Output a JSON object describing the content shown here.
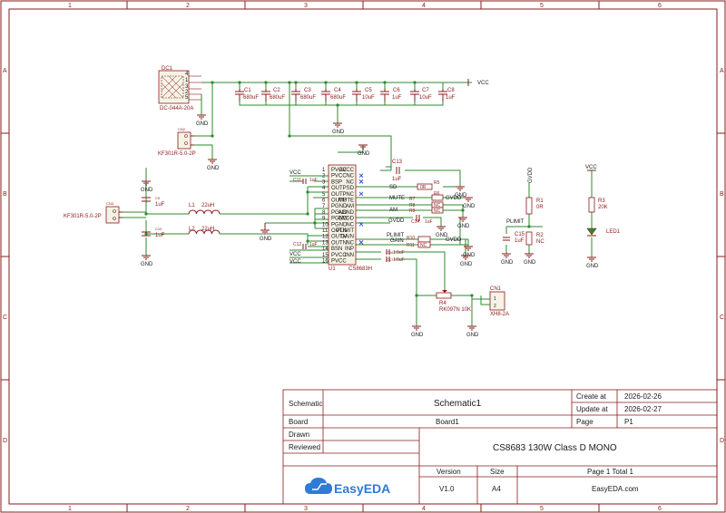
{
  "frame": {
    "columns": [
      "1",
      "2",
      "3",
      "4",
      "5",
      "6"
    ],
    "rows": [
      "A",
      "B",
      "C",
      "D"
    ]
  },
  "title_block": {
    "schematic_label": "Schematic",
    "schematic_name": "Schematic1",
    "board_label": "Board",
    "board_name": "Board1",
    "drawn_label": "Drawn",
    "reviewed_label": "Reviewed",
    "create_label": "Create at",
    "create_date": "2026-02-26",
    "update_label": "Update at",
    "update_date": "2026-02-27",
    "page_label": "Page",
    "page_value": "P1",
    "project_title": "CS8683 130W Class D MONO",
    "version_label": "Version",
    "version_value": "V1.0",
    "size_label": "Size",
    "size_value": "A4",
    "page_count": "Page  1  Total  1",
    "site": "EasyEDA.com",
    "logo_text": "EasyEDA"
  },
  "components": {
    "dc1": {
      "ref": "DC1",
      "value": "DC-044A-20A",
      "pins": [
        "4",
        "1",
        "3",
        "2",
        "5"
      ]
    },
    "c1": {
      "ref": "C1",
      "value": "680uF"
    },
    "c2": {
      "ref": "C2",
      "value": "680uF"
    },
    "c3": {
      "ref": "C3",
      "value": "680uF"
    },
    "c4": {
      "ref": "C4",
      "value": "680uF"
    },
    "c5": {
      "ref": "C5",
      "value": "10uF"
    },
    "c6": {
      "ref": "C6",
      "value": "1uF"
    },
    "c7": {
      "ref": "C7",
      "value": "10uF"
    },
    "c8": {
      "ref": "C8",
      "value": "1uF"
    },
    "cn2": {
      "ref": "CN2",
      "value": "KF301R-5.0-2P"
    },
    "cn3": {
      "ref": "CN3",
      "value": "KF301R-5.0-2P"
    },
    "c9": {
      "ref": "C9",
      "value": "1uF"
    },
    "c10": {
      "ref": "C10",
      "value": "1uF"
    },
    "l1": {
      "ref": "L1",
      "value": "22uH"
    },
    "l2": {
      "ref": "L2",
      "value": "22uH"
    },
    "c11": {
      "ref": "C11",
      "value": "1uF"
    },
    "c12": {
      "ref": "C12",
      "value": "1uF"
    },
    "c13": {
      "ref": "C13",
      "value": "1uF"
    },
    "c14": {
      "ref": "C14",
      "value": "1uF"
    },
    "c16": {
      "ref": "C16",
      "value": "1.5uF"
    },
    "c17": {
      "ref": "C17",
      "value": "1.5uF"
    },
    "u1": {
      "ref": "U1",
      "value": "CS8683H",
      "left_pins": [
        "PVCC",
        "PVCC",
        "BSP",
        "OUTP",
        "OUTP",
        "OUTP",
        "PGND",
        "PGND",
        "PGND",
        "PGND",
        "OUTN",
        "OUTN",
        "OUTN",
        "BSN",
        "PVCC",
        "PVCC"
      ],
      "right_pins": [
        "AVCC",
        "NC",
        "NC",
        "SD",
        "NC",
        "MUTE",
        "AM",
        "AGND",
        "GVDD",
        "NC",
        "PLIMIT",
        "GAIN",
        "NC",
        "INP",
        "INN"
      ],
      "left_nums": [
        "1",
        "2",
        "3",
        "4",
        "5",
        "6",
        "7",
        "8",
        "9",
        "10",
        "11",
        "12",
        "13",
        "14",
        "15",
        "16"
      ],
      "right_nums": [
        "30",
        "29",
        "28",
        "27",
        "26",
        "25",
        "24",
        "23",
        "22",
        "21",
        "20",
        "19",
        "18",
        "17"
      ]
    },
    "r5": {
      "ref": "R5",
      "value": "0R"
    },
    "r6": {
      "ref": "R6",
      "value": ""
    },
    "r7": {
      "ref": "R7",
      "value": ""
    },
    "r8": {
      "ref": "R8",
      "value": "NC"
    },
    "r9": {
      "ref": "R9",
      "value": "NC"
    },
    "r10": {
      "ref": "R10",
      "value": ""
    },
    "r11": {
      "ref": "R11",
      "value": "NC"
    },
    "r4": {
      "ref": "R4",
      "value": "RK097N 10K"
    },
    "cn1": {
      "ref": "CN1",
      "value": "XH8-2A"
    },
    "r1": {
      "ref": "R1",
      "value": "0R"
    },
    "r2": {
      "ref": "R2",
      "value": "NC"
    },
    "c15": {
      "ref": "C15",
      "value": "1uF"
    },
    "r3": {
      "ref": "R3",
      "value": "20K"
    },
    "led1": {
      "ref": "LED1",
      "value": ""
    }
  },
  "nets": {
    "vcc": "VCC",
    "gnd": "GND",
    "gvdd": "GVDD",
    "sd": "SD",
    "mute": "MUTE",
    "am": "AM",
    "plimit": "PLIMIT",
    "gain": "GAIN"
  },
  "colors": {
    "wire": "#2d8a2d",
    "part": "#8a1a1a",
    "frame": "#8a1a1a",
    "body_fill": "#f5f2e6",
    "logo": "#2f7bd6"
  }
}
